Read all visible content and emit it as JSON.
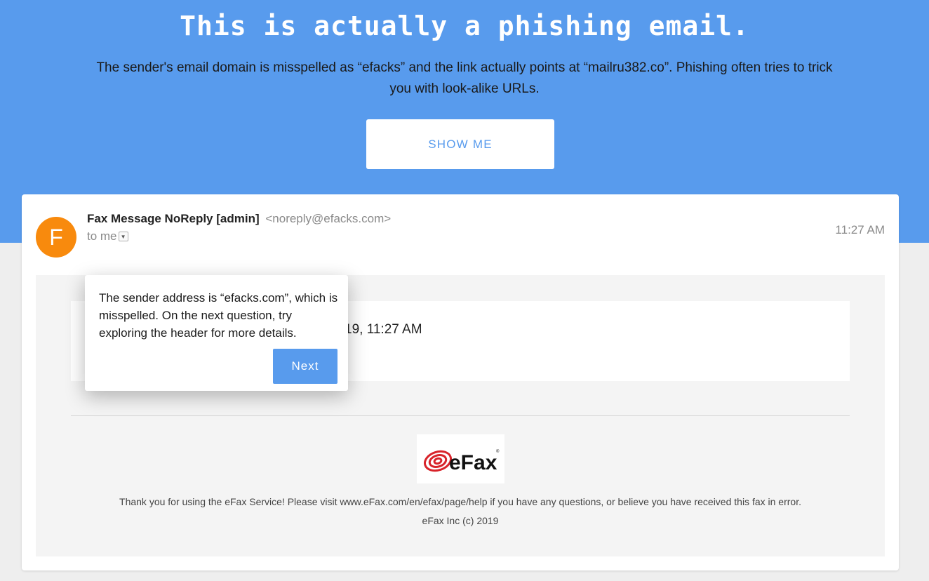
{
  "banner": {
    "headline": "This is actually a phishing email.",
    "explanation": "The sender's email domain is misspelled as “efacks” and the link actually points at “mailru382.co”. Phishing often tries to trick you with look-alike URLs.",
    "show_me_label": "SHOW ME",
    "background_color": "#589bed"
  },
  "email": {
    "avatar_letter": "F",
    "avatar_color": "#f88a0d",
    "sender_name": "Fax Message NoReply [admin]",
    "sender_email": "<noreply@efacks.com>",
    "recipient": "to me",
    "time": "11:27 AM",
    "body": {
      "date_fragment": "19, 11:27 AM",
      "logo_text": "eFax",
      "footer_text": "Thank you for using the eFax Service! Please visit www.eFax.com/en/efax/page/help if you have any questions, or believe you have received this fax in error.",
      "copyright": "eFax Inc (c) 2019"
    }
  },
  "tooltip": {
    "text": "The sender address is “efacks.com”, which is misspelled. On the next question, try exploring the header for more details.",
    "next_label": "Next"
  }
}
